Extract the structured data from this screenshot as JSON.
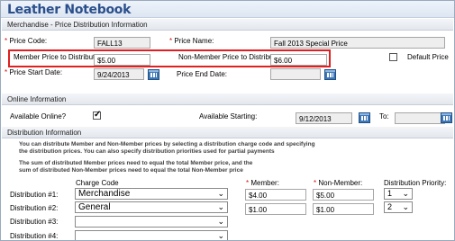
{
  "header": {
    "title": "Leather Notebook"
  },
  "sections": {
    "price_dist": "Merchandise - Price Distribution Information",
    "online": "Online Information",
    "distribution": "Distribution Information"
  },
  "price": {
    "code_label": "Price Code:",
    "code_value": "FALL13",
    "name_label": "Price Name:",
    "name_value": "Fall 2013 Special Price",
    "member_label": "Member Price to Distribute:",
    "member_value": "$5.00",
    "nonmember_label": "Non-Member Price to Distribute:",
    "nonmember_value": "$6.00",
    "default_label": "Default Price",
    "start_label": "Price Start Date:",
    "start_value": "9/24/2013",
    "end_label": "Price End Date:",
    "end_value": ""
  },
  "online": {
    "available_label": "Available Online?",
    "available_checked": true,
    "starting_label": "Available Starting:",
    "starting_value": "9/12/2013",
    "to_label": "To:",
    "to_value": ""
  },
  "distribution": {
    "note1": "You can distribute Member and Non-Member prices by selecting a distribution charge code and specifying",
    "note2": "the distribution prices. You can also specify distribution priorities used for partial payments",
    "note3": "The sum of distributed Member prices need to equal the total Member price, and the",
    "note4": "sum of distributed Non-Member prices need to equal the total Non-Member price",
    "col_charge": "Charge Code",
    "col_member": "Member:",
    "col_nonmember": "Non-Member:",
    "col_priority": "Distribution Priority:",
    "rows": [
      {
        "label": "Distribution #1:",
        "charge": "Merchandise",
        "member": "$4.00",
        "nonmember": "$5.00",
        "priority": "1"
      },
      {
        "label": "Distribution #2:",
        "charge": "General",
        "member": "$1.00",
        "nonmember": "$1.00",
        "priority": "2"
      },
      {
        "label": "Distribution #3:",
        "charge": "",
        "member": "",
        "nonmember": "",
        "priority": ""
      },
      {
        "label": "Distribution #4:",
        "charge": "",
        "member": "",
        "nonmember": "",
        "priority": ""
      }
    ]
  },
  "icons": {
    "calendar": "calendar-icon",
    "dropdown": "chevron-down-icon"
  },
  "colors": {
    "highlight": "#e02020",
    "title": "#2a4f8c",
    "required": "#d01010"
  }
}
